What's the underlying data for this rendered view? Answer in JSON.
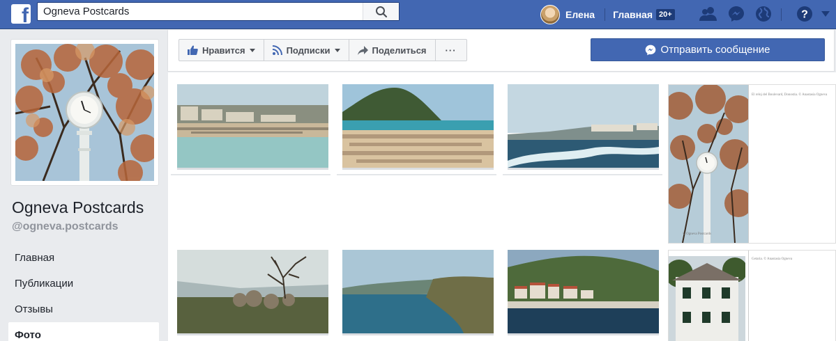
{
  "topbar": {
    "search_value": "Ogneva Postcards",
    "search_icon": "search-icon",
    "user_name": "Елена",
    "home_label": "Главная",
    "home_badge": "20+",
    "icons": [
      "friends-icon",
      "messenger-icon",
      "globe-icon",
      "help-icon"
    ],
    "brand_color": "#4267b2"
  },
  "page": {
    "name": "Ogneva Postcards",
    "handle": "@ogneva.postcards"
  },
  "side_nav": {
    "items": [
      {
        "label": "Главная",
        "active": false
      },
      {
        "label": "Публикации",
        "active": false
      },
      {
        "label": "Отзывы",
        "active": false
      },
      {
        "label": "Фото",
        "active": true
      }
    ]
  },
  "actions": {
    "like_label": "Нравится",
    "follow_label": "Подписки",
    "share_label": "Поделиться",
    "more_label": "···",
    "message_label": "Отправить сообщение"
  },
  "postcard": {
    "caption_top": "El reloj del Boulevard, Donostia. © Anastasia Ogneva",
    "caption_bottom": "© Ogneva Postcards",
    "caption_second": "Getaria. © Anastasia Ogneva"
  }
}
